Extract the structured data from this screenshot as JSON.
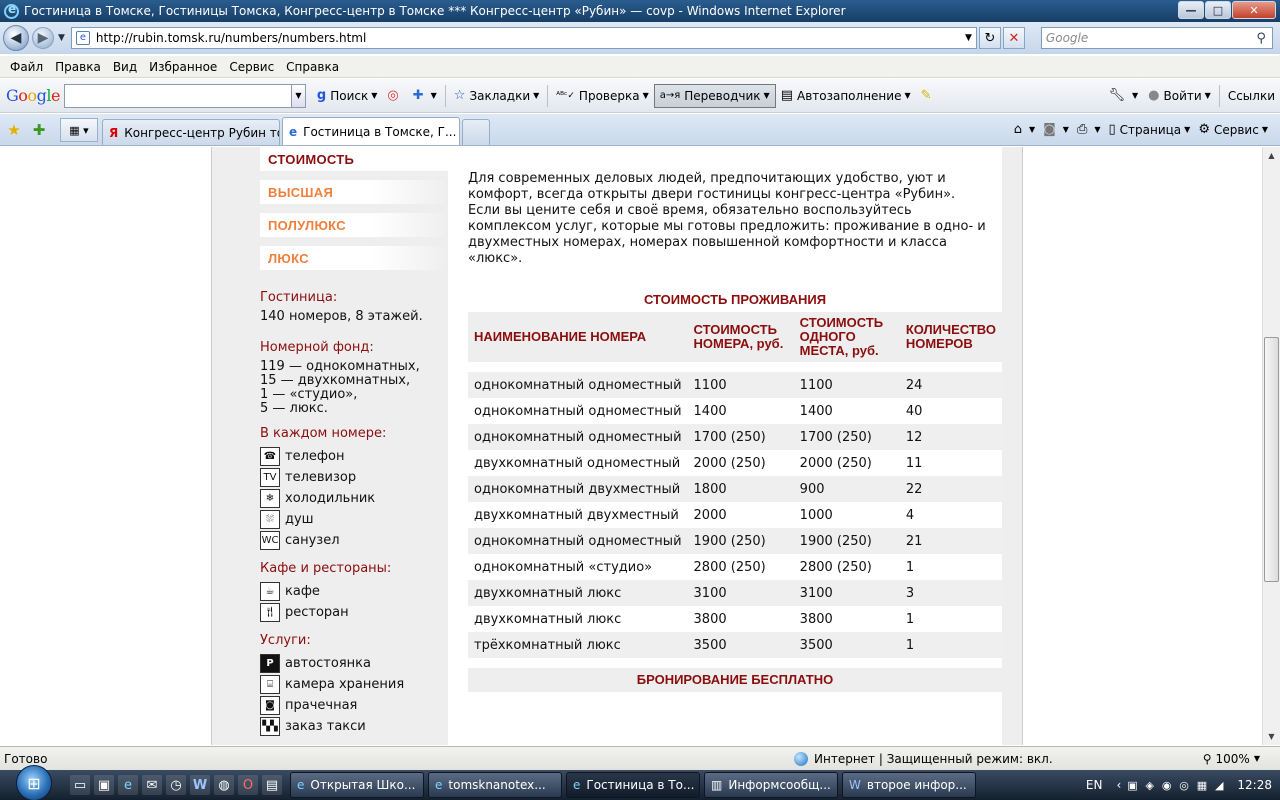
{
  "window": {
    "title": "Гостиница в Томске, Гостиницы Томска, Конгресс-центр в Томске *** Конгресс-центр «Рубин» — сovp - Windows Internet Explorer",
    "minimize": "—",
    "maximize": "□",
    "close": "✕"
  },
  "address": {
    "url": "http://rubin.tomsk.ru/numbers/numbers.html",
    "search_placeholder": "Google"
  },
  "menu": [
    "Файл",
    "Правка",
    "Вид",
    "Избранное",
    "Сервис",
    "Справка"
  ],
  "google_toolbar": {
    "logo": "Google",
    "search_btn": "Поиск",
    "bookmarks": "Закладки",
    "check": "Проверка",
    "translator": "Переводчик",
    "autofill": "Автозаполнение",
    "signin": "Войти",
    "links": "Ссылки"
  },
  "tabs": [
    {
      "label": "Конгресс-центр Рубин то...",
      "icon": "yandex-icon"
    },
    {
      "label": "Гостиница в Томске, Г...",
      "icon": "ie-icon"
    }
  ],
  "tab_tools": {
    "page": "Страница",
    "service": "Сервис"
  },
  "sidebar": {
    "menu": [
      "СТОИМОСТЬ",
      "ВЫСШАЯ",
      "ПОЛУЛЮКС",
      "ЛЮКС"
    ],
    "hotel_h": "Гостиница:",
    "hotel_t": "140 номеров, 8 этажей.",
    "fund_h": "Номерной фонд:",
    "fund_lines": [
      "119 — однокомнатных,",
      "15 — двухкомнатных,",
      "1 — «студио»,",
      "5 — люкс."
    ],
    "room_h": "В каждом номере:",
    "room_items": [
      "телефон",
      "телевизор",
      "холодильник",
      "душ",
      "санузел"
    ],
    "cafe_h": "Кафе и рестораны:",
    "cafe_items": [
      "кафе",
      "ресторан"
    ],
    "services_h": "Услуги:",
    "services_items": [
      "автостоянка",
      "камера хранения",
      "прачечная",
      "заказ такси"
    ]
  },
  "main": {
    "intro": "Для современных деловых людей, предпочитающих удобство, уют и комфорт, всегда открыты двери гостиницы конгресс-центра «Рубин». Если вы цените себя и своё время, обязательно воспользуйтесь комплексом услуг, которые мы готовы предложить: проживание в одно- и двухместных номерах, номерах повышенной комфортности и класса «люкс».",
    "table_title": "СТОИМОСТЬ ПРОЖИВАНИЯ",
    "headers": [
      "НАИМЕНОВАНИЕ НОМЕРА",
      "СТОИМОСТЬ НОМЕРА, руб.",
      "СТОИМОСТЬ ОДНОГО МЕСТА, руб.",
      "КОЛИЧЕСТВО НОМЕРОВ"
    ],
    "rows": [
      [
        "однокомнатный одноместный",
        "1100",
        "1100",
        "24"
      ],
      [
        "однокомнатный одноместный",
        "1400",
        "1400",
        "40"
      ],
      [
        "однокомнатный одноместный",
        "1700 (250)",
        "1700 (250)",
        "12"
      ],
      [
        "двухкомнатный одноместный",
        "2000 (250)",
        "2000 (250)",
        "11"
      ],
      [
        "однокомнатный двухместный",
        "1800",
        "900",
        "22"
      ],
      [
        "двухкомнатный двухместный",
        "2000",
        "1000",
        "4"
      ],
      [
        "однокомнатный одноместный",
        "1900 (250)",
        "1900 (250)",
        "21"
      ],
      [
        "однокомнатный «студио»",
        "2800 (250)",
        "2800 (250)",
        "1"
      ],
      [
        "двухкомнатный люкс",
        "3100",
        "3100",
        "3"
      ],
      [
        "двухкомнатный люкс",
        "3800",
        "3800",
        "1"
      ],
      [
        "трёхкомнатный люкс",
        "3500",
        "3500",
        "1"
      ]
    ],
    "booking": "БРОНИРОВАНИЕ БЕСПЛАТНО"
  },
  "status": {
    "left": "Готово",
    "zone": "Интернет | Защищенный режим: вкл.",
    "zoom": "100%"
  },
  "taskbar": {
    "tasks": [
      "Открытая Шко...",
      "tomsknanotex...",
      "Гостиница в То...",
      "Информсообщ...",
      "второе инфор..."
    ],
    "lang": "EN",
    "time": "12:28"
  }
}
